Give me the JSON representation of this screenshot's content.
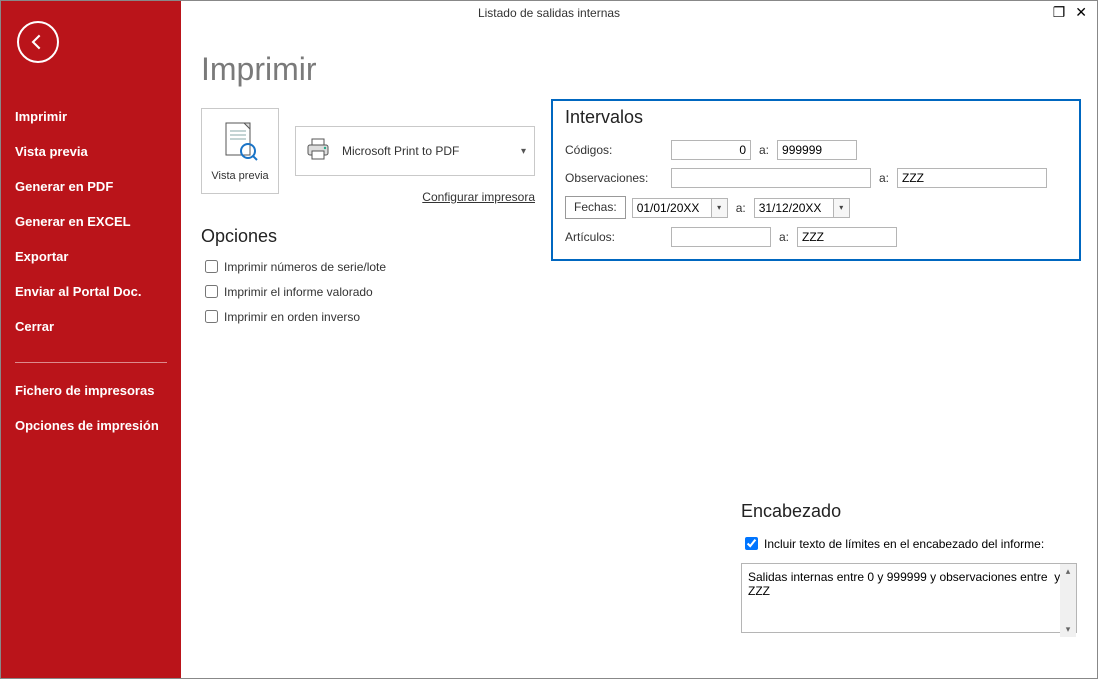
{
  "window": {
    "title": "Listado de salidas internas"
  },
  "sidebar": {
    "items": [
      "Imprimir",
      "Vista previa",
      "Generar en PDF",
      "Generar en EXCEL",
      "Exportar",
      "Enviar al Portal Doc.",
      "Cerrar"
    ],
    "items2": [
      "Fichero de impresoras",
      "Opciones de impresión"
    ]
  },
  "page": {
    "title": "Imprimir",
    "preview_label": "Vista previa",
    "printer_selected": "Microsoft Print to PDF",
    "configure_link": "Configurar impresora"
  },
  "options": {
    "title": "Opciones",
    "opt1": "Imprimir números de serie/lote",
    "opt2": "Imprimir el informe valorado",
    "opt3": "Imprimir en orden inverso"
  },
  "intervals": {
    "title": "Intervalos",
    "sep": "a:",
    "codigos": {
      "label": "Códigos:",
      "from": "0",
      "to": "999999"
    },
    "observaciones": {
      "label": "Observaciones:",
      "from": "",
      "to": "ZZZ"
    },
    "fechas": {
      "label": "Fechas:",
      "from": "01/01/20XX",
      "to": "31/12/20XX"
    },
    "articulos": {
      "label": "Artículos:",
      "from": "",
      "to": "ZZZ"
    }
  },
  "encabezado": {
    "title": "Encabezado",
    "checkbox_label": "Incluir texto de límites en el encabezado del informe:",
    "checked": true,
    "text": "Salidas internas entre 0 y 999999 y observaciones entre  y ZZZ"
  }
}
